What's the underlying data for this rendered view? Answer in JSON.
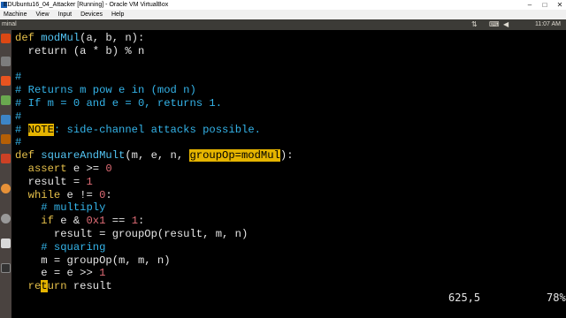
{
  "window": {
    "title": "EDUbuntu16_04_Attacker [Running] - Oracle VM VirtualBox",
    "menu": [
      "Machine",
      "View",
      "Input",
      "Devices",
      "Help"
    ]
  },
  "panel": {
    "title": "minal",
    "clock": "11:07 AM"
  },
  "code": [
    [
      {
        "t": "def ",
        "c": "kw"
      },
      {
        "t": "modMul",
        "c": "fn"
      },
      {
        "t": "(a, b, n):",
        "c": "n"
      }
    ],
    [
      {
        "t": "  return (a * b) % n",
        "c": "n"
      }
    ],
    [],
    [
      {
        "t": "#",
        "c": "cm"
      }
    ],
    [
      {
        "t": "# Returns m pow e in (mod n)",
        "c": "cm"
      }
    ],
    [
      {
        "t": "# If m = 0 and e = 0, returns 1.",
        "c": "cm"
      }
    ],
    [
      {
        "t": "#",
        "c": "cm"
      }
    ],
    [
      {
        "t": "# ",
        "c": "cm"
      },
      {
        "t": "NOTE",
        "c": "hl"
      },
      {
        "t": ": side-channel attacks possible.",
        "c": "cm"
      }
    ],
    [
      {
        "t": "#",
        "c": "cm"
      }
    ],
    [
      {
        "t": "def ",
        "c": "kw"
      },
      {
        "t": "squareAndMult",
        "c": "fn"
      },
      {
        "t": "(m, e, n, ",
        "c": "n"
      },
      {
        "t": "groupOp=modMul",
        "c": "hl"
      },
      {
        "t": "):",
        "c": "n"
      }
    ],
    [
      {
        "t": "  assert ",
        "c": "kw"
      },
      {
        "t": "e >= ",
        "c": "n"
      },
      {
        "t": "0",
        "c": "num"
      }
    ],
    [
      {
        "t": "  result = ",
        "c": "n"
      },
      {
        "t": "1",
        "c": "num"
      }
    ],
    [
      {
        "t": "  while ",
        "c": "kw"
      },
      {
        "t": "e != ",
        "c": "n"
      },
      {
        "t": "0",
        "c": "num"
      },
      {
        "t": ":",
        "c": "n"
      }
    ],
    [
      {
        "t": "    # multiply",
        "c": "cm"
      }
    ],
    [
      {
        "t": "    if ",
        "c": "kw"
      },
      {
        "t": "e & ",
        "c": "n"
      },
      {
        "t": "0x1",
        "c": "num"
      },
      {
        "t": " == ",
        "c": "n"
      },
      {
        "t": "1",
        "c": "num"
      },
      {
        "t": ":",
        "c": "n"
      }
    ],
    [
      {
        "t": "      result = groupOp(result, m, n)",
        "c": "n"
      }
    ],
    [
      {
        "t": "    # squaring",
        "c": "cm"
      }
    ],
    [
      {
        "t": "    m = groupOp(m, m, n)",
        "c": "n"
      }
    ],
    [
      {
        "t": "    e = e >> ",
        "c": "n"
      },
      {
        "t": "1",
        "c": "num"
      }
    ],
    [
      {
        "t": "  re",
        "c": "kw"
      },
      {
        "t": "t",
        "c": "cursor"
      },
      {
        "t": "urn ",
        "c": "kw"
      },
      {
        "t": "result",
        "c": "n"
      }
    ]
  ],
  "status": {
    "position": "625,5",
    "percent": "78%"
  }
}
